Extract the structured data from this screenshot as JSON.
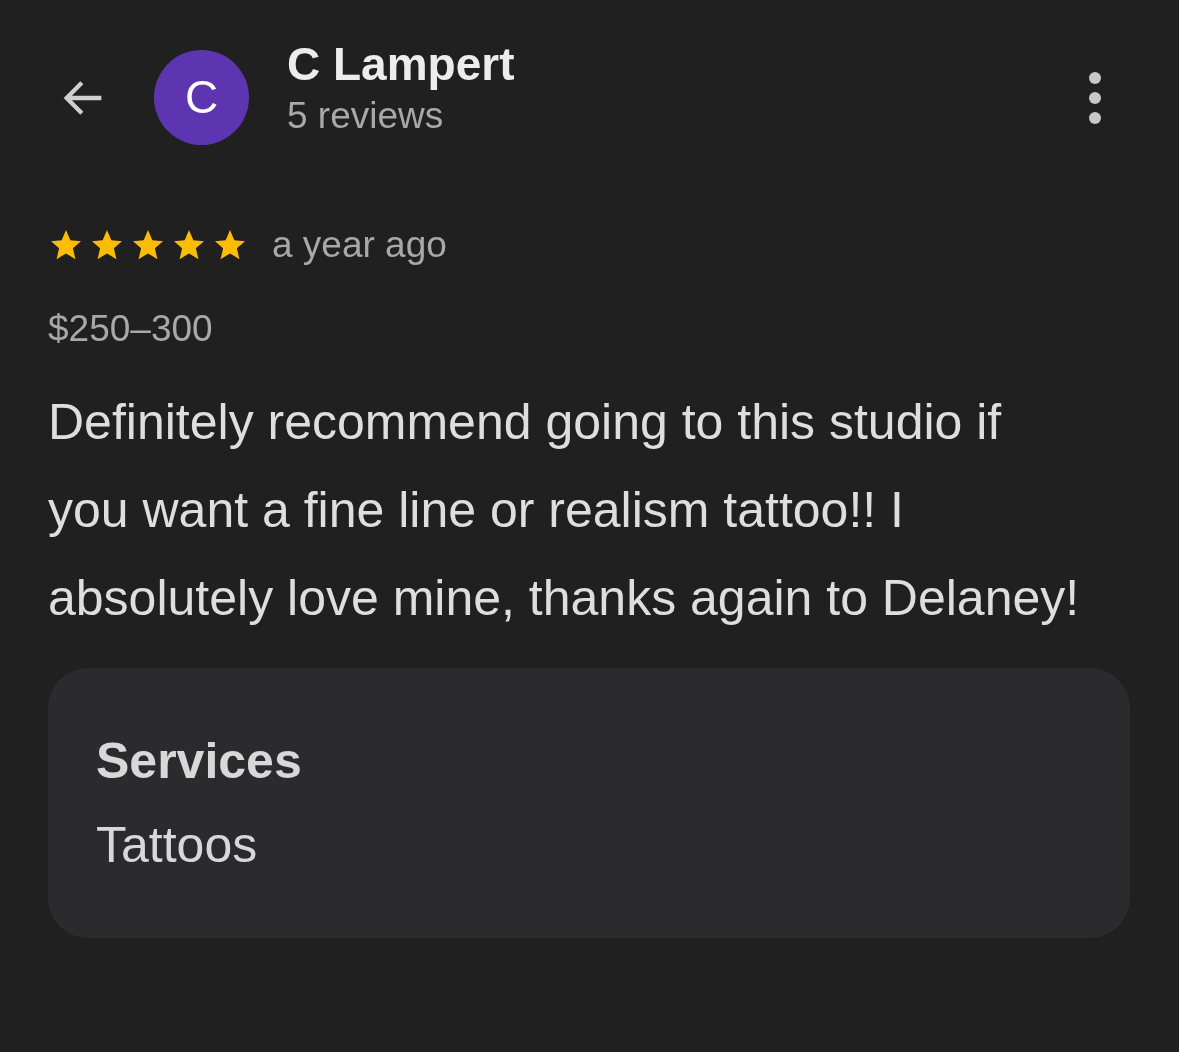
{
  "header": {
    "avatar_letter": "C",
    "name": "C Lampert",
    "subtitle": "5 reviews"
  },
  "review": {
    "stars": 5,
    "time": "a year ago",
    "price": "$250–300",
    "text": "Definitely recommend going to this studio if you want a fine line or realism tattoo!! I absolutely love mine, thanks again to Delaney!"
  },
  "details": {
    "label": "Services",
    "value": "Tattoos"
  }
}
